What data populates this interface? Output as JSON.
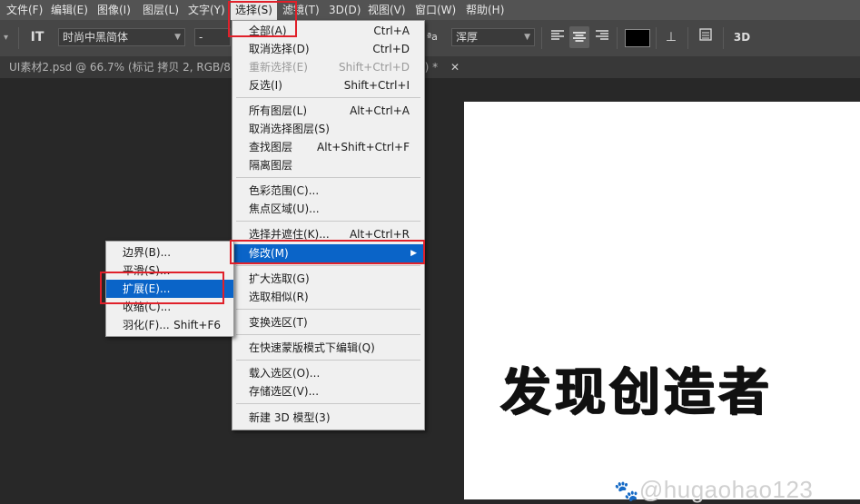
{
  "menubar": {
    "items": [
      {
        "label": "文件(F)"
      },
      {
        "label": "编辑(E)"
      },
      {
        "label": "图像(I)"
      },
      {
        "label": "图层(L)"
      },
      {
        "label": "文字(Y)"
      },
      {
        "label": "选择(S)"
      },
      {
        "label": "滤镜(T)"
      },
      {
        "label": "3D(D)"
      },
      {
        "label": "视图(V)"
      },
      {
        "label": "窗口(W)"
      },
      {
        "label": "帮助(H)"
      }
    ]
  },
  "options": {
    "font_family": "时尚中黑简体",
    "font_style": "-",
    "aa_label": "ªa",
    "antialias": "浑厚",
    "three_d": "3D"
  },
  "tabs": {
    "doc1": "UI素材2.psd @ 66.7% (标记 拷贝 2, RGB/8)",
    "doc2_suffix": "8) *"
  },
  "select_menu": {
    "items": [
      {
        "label": "全部(A)",
        "shortcut": "Ctrl+A"
      },
      {
        "label": "取消选择(D)",
        "shortcut": "Ctrl+D"
      },
      {
        "label": "重新选择(E)",
        "shortcut": "Shift+Ctrl+D"
      },
      {
        "label": "反选(I)",
        "shortcut": "Shift+Ctrl+I"
      },
      {
        "label": "所有图层(L)",
        "shortcut": "Alt+Ctrl+A"
      },
      {
        "label": "取消选择图层(S)",
        "shortcut": ""
      },
      {
        "label": "查找图层",
        "shortcut": "Alt+Shift+Ctrl+F"
      },
      {
        "label": "隔离图层",
        "shortcut": ""
      },
      {
        "label": "色彩范围(C)...",
        "shortcut": ""
      },
      {
        "label": "焦点区域(U)...",
        "shortcut": ""
      },
      {
        "label": "选择并遮住(K)...",
        "shortcut": "Alt+Ctrl+R"
      },
      {
        "label": "修改(M)",
        "shortcut": ""
      },
      {
        "label": "扩大选取(G)",
        "shortcut": ""
      },
      {
        "label": "选取相似(R)",
        "shortcut": ""
      },
      {
        "label": "变换选区(T)",
        "shortcut": ""
      },
      {
        "label": "在快速蒙版模式下编辑(Q)",
        "shortcut": ""
      },
      {
        "label": "载入选区(O)...",
        "shortcut": ""
      },
      {
        "label": "存储选区(V)...",
        "shortcut": ""
      },
      {
        "label": "新建 3D 模型(3)",
        "shortcut": ""
      }
    ]
  },
  "modify_menu": {
    "items": [
      {
        "label": "边界(B)...",
        "shortcut": ""
      },
      {
        "label": "平滑(S)...",
        "shortcut": ""
      },
      {
        "label": "扩展(E)...",
        "shortcut": ""
      },
      {
        "label": "收缩(C)...",
        "shortcut": ""
      },
      {
        "label": "羽化(F)...",
        "shortcut": "Shift+F6"
      }
    ]
  },
  "canvas": {
    "text": "发现创造者",
    "watermark": "@hugaohao123"
  },
  "colors": {
    "highlight": "#0a64c8",
    "annotation_red": "#e0202a",
    "menubar_bg": "#535353",
    "foreground_swatch": "#000000"
  }
}
